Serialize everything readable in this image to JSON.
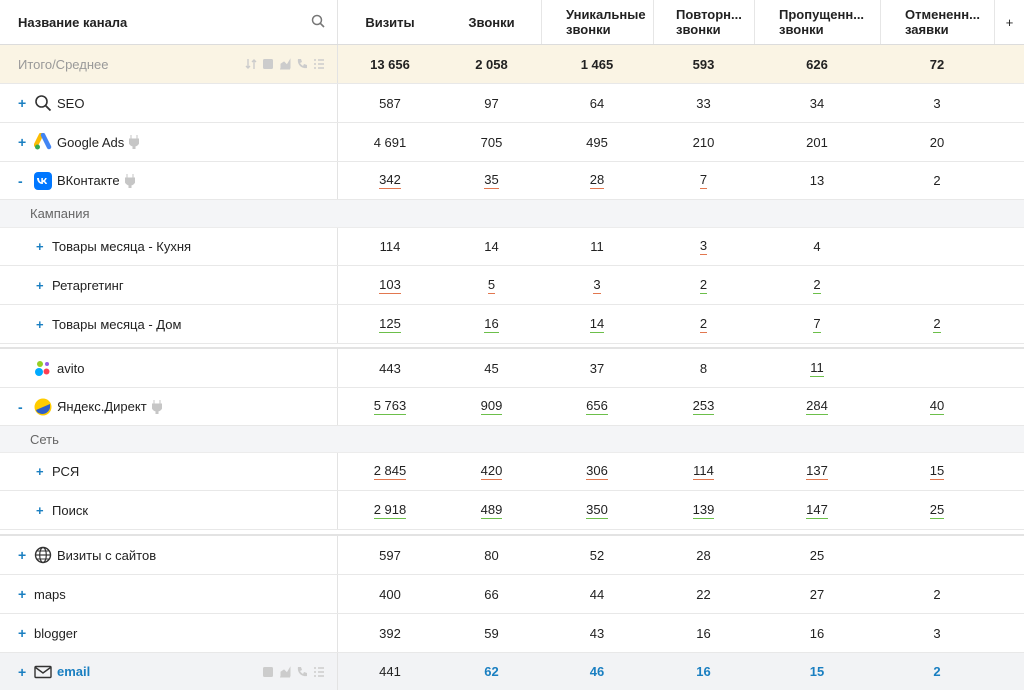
{
  "header": {
    "name": "Название канала",
    "visits": "Визиты",
    "calls": "Звонки",
    "unique_1": "Уникальные",
    "unique_2": "звонки",
    "repeat_1": "Повторн...",
    "repeat_2": "звонки",
    "missed_1": "Пропущенн...",
    "missed_2": "звонки",
    "cancel_1": "Отмененн...",
    "cancel_2": "заявки",
    "add": "+"
  },
  "totals": {
    "label": "Итого/Среднее",
    "v": [
      "13 656",
      "2 058",
      "1 465",
      "593",
      "626",
      "72"
    ]
  },
  "rows": {
    "seo": {
      "exp": "+",
      "name": "SEO",
      "v": [
        "587",
        "97",
        "64",
        "33",
        "34",
        "3"
      ]
    },
    "gads": {
      "exp": "+",
      "name": "Google Ads",
      "v": [
        "4 691",
        "705",
        "495",
        "210",
        "201",
        "20"
      ]
    },
    "vk": {
      "exp": "-",
      "name": "ВКонтакте",
      "v": [
        "342",
        "35",
        "28",
        "7",
        "13",
        "2"
      ]
    },
    "vk_group": "Кампания",
    "vk1": {
      "exp": "+",
      "name": "Товары месяца - Кухня",
      "v": [
        "114",
        "14",
        "11",
        "3",
        "4",
        ""
      ]
    },
    "vk2": {
      "exp": "+",
      "name": "Ретаргетинг",
      "v": [
        "103",
        "5",
        "3",
        "2",
        "2",
        ""
      ]
    },
    "vk3": {
      "exp": "+",
      "name": "Товары месяца - Дом",
      "v": [
        "125",
        "16",
        "14",
        "2",
        "7",
        "2"
      ]
    },
    "avito": {
      "exp": "",
      "name": "avito",
      "v": [
        "443",
        "45",
        "37",
        "8",
        "11",
        ""
      ]
    },
    "yd": {
      "exp": "-",
      "name": "Яндекс.Директ",
      "v": [
        "5 763",
        "909",
        "656",
        "253",
        "284",
        "40"
      ]
    },
    "yd_group": "Сеть",
    "yd1": {
      "exp": "+",
      "name": "РСЯ",
      "v": [
        "2 845",
        "420",
        "306",
        "114",
        "137",
        "15"
      ]
    },
    "yd2": {
      "exp": "+",
      "name": "Поиск",
      "v": [
        "2 918",
        "489",
        "350",
        "139",
        "147",
        "25"
      ]
    },
    "sites": {
      "exp": "+",
      "name": "Визиты с сайтов",
      "v": [
        "597",
        "80",
        "52",
        "28",
        "25",
        ""
      ]
    },
    "maps": {
      "exp": "+",
      "name": "maps",
      "v": [
        "400",
        "66",
        "44",
        "22",
        "27",
        "2"
      ]
    },
    "blogger": {
      "exp": "+",
      "name": "blogger",
      "v": [
        "392",
        "59",
        "43",
        "16",
        "16",
        "3"
      ]
    },
    "email": {
      "exp": "+",
      "name": "email",
      "v": [
        "441",
        "62",
        "46",
        "16",
        "15",
        "2"
      ]
    }
  },
  "colors": {
    "accent": "#1a7fc1",
    "underline_red": "#e2774f",
    "underline_green": "#6cbf4a",
    "totals_bg": "#faf4e4"
  }
}
